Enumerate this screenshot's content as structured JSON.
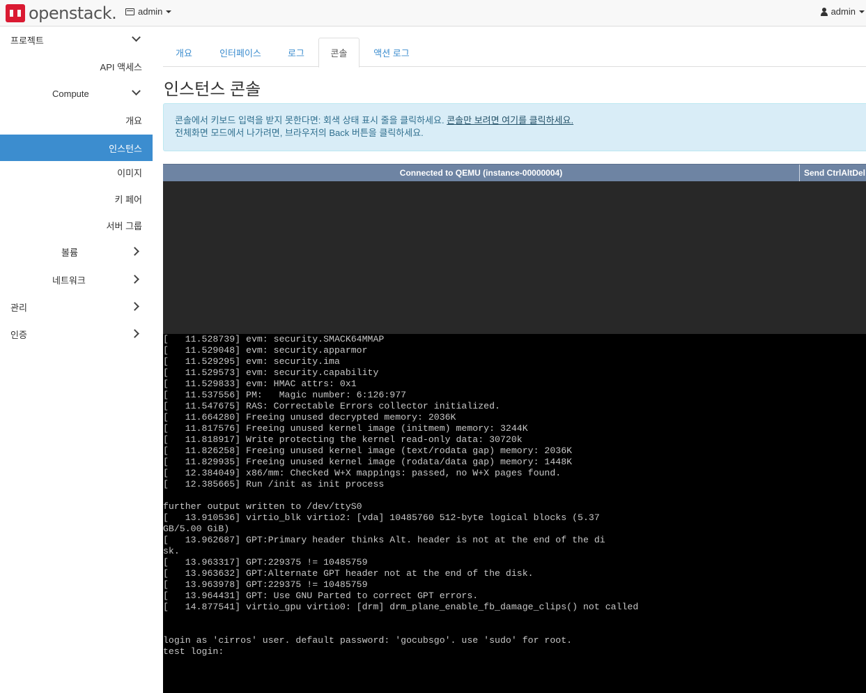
{
  "header": {
    "brand": "openstack.",
    "project": "admin",
    "user": "admin"
  },
  "sidebar": {
    "items": [
      {
        "label": "프로젝트"
      },
      {
        "label": "API 액세스"
      },
      {
        "label": "Compute"
      },
      {
        "label": "개요"
      },
      {
        "label": "인스턴스"
      },
      {
        "label": "이미지"
      },
      {
        "label": "키 페어"
      },
      {
        "label": "서버 그룹"
      },
      {
        "label": "볼륨"
      },
      {
        "label": "네트워크"
      },
      {
        "label": "관리"
      },
      {
        "label": "인증"
      }
    ]
  },
  "tabs": [
    {
      "label": "개요"
    },
    {
      "label": "인터페이스"
    },
    {
      "label": "로그"
    },
    {
      "label": "콘솔"
    },
    {
      "label": "액션 로그"
    }
  ],
  "page_title": "인스턴스 콘솔",
  "alert": {
    "line1_text": "콘솔에서 키보드 입력을 받지 못한다면: 회색 상태 표시 줄을 클릭하세요.",
    "line1_link": "콘솔만 보려면 여기를 클릭하세요.",
    "line2_text": "전체화면 모드에서 나가려면, 브라우저의 Back 버튼을 클릭하세요."
  },
  "console": {
    "status": "Connected to QEMU (instance-00000004)",
    "send_button": "Send CtrlAltDel",
    "lines": [
      "[   11.528739] evm: security.SMACK64MMAP",
      "[   11.529048] evm: security.apparmor",
      "[   11.529295] evm: security.ima",
      "[   11.529573] evm: security.capability",
      "[   11.529833] evm: HMAC attrs: 0x1",
      "[   11.537556] PM:   Magic number: 6:126:977",
      "[   11.547675] RAS: Correctable Errors collector initialized.",
      "[   11.664280] Freeing unused decrypted memory: 2036K",
      "[   11.817576] Freeing unused kernel image (initmem) memory: 3244K",
      "[   11.818917] Write protecting the kernel read-only data: 30720k",
      "[   11.826258] Freeing unused kernel image (text/rodata gap) memory: 2036K",
      "[   11.829935] Freeing unused kernel image (rodata/data gap) memory: 1448K",
      "[   12.384049] x86/mm: Checked W+X mappings: passed, no W+X pages found.",
      "[   12.385665] Run /init as init process",
      "",
      "further output written to /dev/ttyS0",
      "[   13.910536] virtio_blk virtio2: [vda] 10485760 512-byte logical blocks (5.37",
      "GB/5.00 GiB)",
      "[   13.962687] GPT:Primary header thinks Alt. header is not at the end of the di",
      "sk.",
      "[   13.963317] GPT:229375 != 10485759",
      "[   13.963632] GPT:Alternate GPT header not at the end of the disk.",
      "[   13.963978] GPT:229375 != 10485759",
      "[   13.964431] GPT: Use GNU Parted to correct GPT errors.",
      "[   14.877541] virtio_gpu virtio0: [drm] drm_plane_enable_fb_damage_clips() not called",
      "",
      "",
      "login as 'cirros' user. default password: 'gocubsgo'. use 'sudo' for root.",
      "test login:"
    ]
  }
}
